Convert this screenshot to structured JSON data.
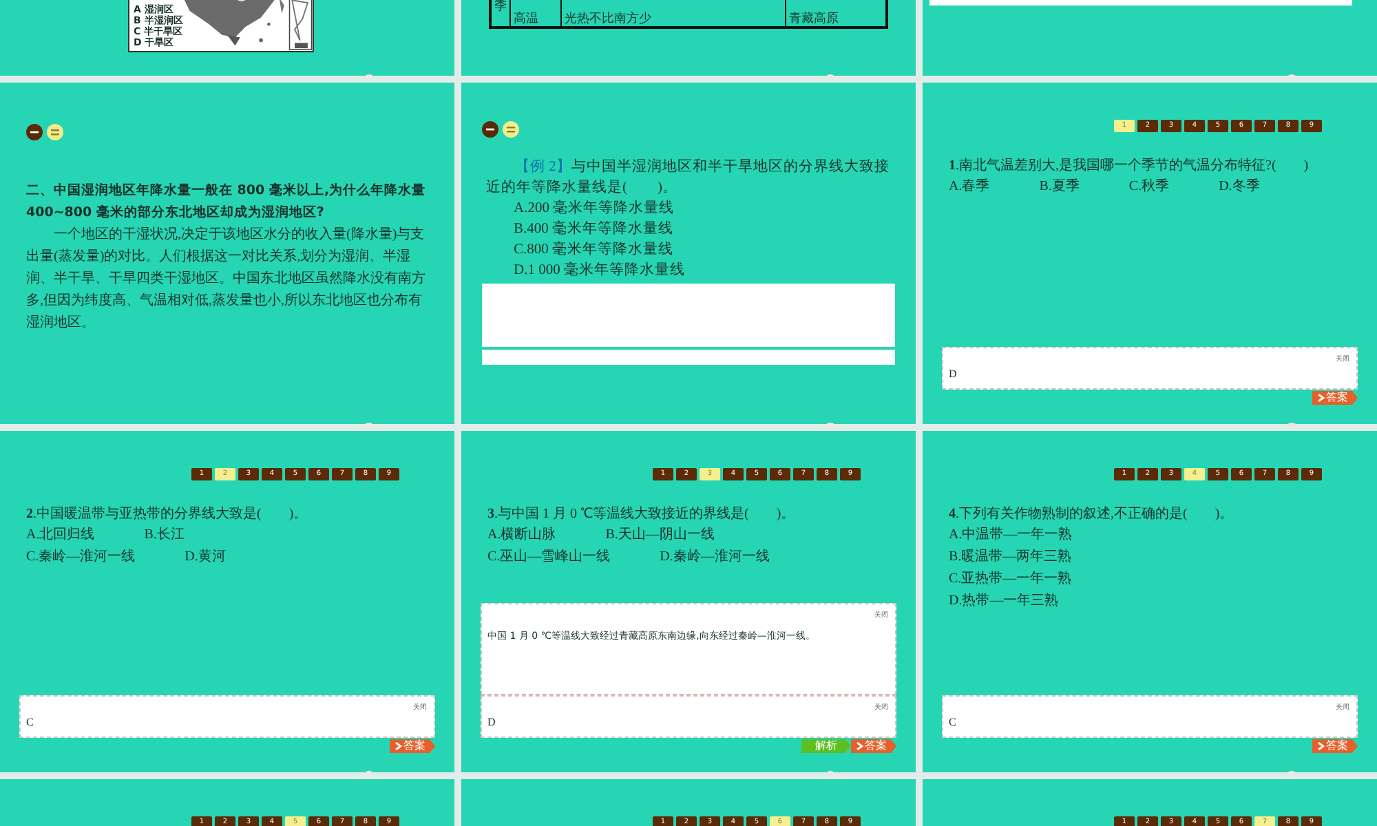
{
  "slides": [
    {
      "kind": "map",
      "legend": [
        "A 湿润区",
        "B 半湿润区",
        "C 半干旱区",
        "D 干旱区"
      ]
    },
    {
      "kind": "table",
      "cells": [
        {
          "text": "季"
        },
        {
          "text": "高温"
        },
        {
          "text": "光热不比南方少"
        },
        {
          "text": "青藏高原"
        }
      ]
    },
    {
      "kind": "strip"
    },
    {
      "kind": "text",
      "heading": "二、中国湿润地区年降水量一般在 800 毫米以上,为什么年降水量 400~800 毫米的部分东北地区却成为湿润地区?",
      "paragraph": "一个地区的干湿状况,决定于该地区水分的收入量(降水量)与支出量(蒸发量)的对比。人们根据这一对比关系,划分为湿润、半湿润、半干旱、干旱四类干湿地区。中国东北地区虽然降水没有南方多,但因为纬度高、气温相对低,蒸发量也小,所以东北地区也分布有湿润地区。"
    },
    {
      "kind": "example",
      "tag": "【例 2】",
      "question": "与中国半湿润地区和半干旱地区的分界线大致接近的年等降水量线是(　　)。",
      "options": [
        "A.200 毫米年等降水量线",
        "B.400 毫米年等降水量线",
        "C.800 毫米年等降水量线",
        "D.1 000 毫米年等降水量线"
      ]
    },
    {
      "kind": "quiz",
      "nav": [
        {
          "label": "1",
          "selected": true
        },
        {
          "label": "2",
          "selected": false
        },
        {
          "label": "3",
          "selected": false
        },
        {
          "label": "4",
          "selected": false
        },
        {
          "label": "5",
          "selected": false
        },
        {
          "label": "6",
          "selected": false
        },
        {
          "label": "7",
          "selected": false
        },
        {
          "label": "8",
          "selected": false
        },
        {
          "label": "9",
          "selected": false
        }
      ],
      "question": "**1**.南北气温差别大,是我国哪一个季节的气温分布特征?(　　)",
      "option_rows": [
        [
          "A.春季",
          "B.夏季",
          "C.秋季",
          "D.冬季"
        ]
      ],
      "boxes": [
        {
          "kind": "answer",
          "close": "关闭",
          "text": "D"
        }
      ],
      "buttons": [
        {
          "kind": "answer",
          "label": "答案"
        }
      ]
    },
    {
      "kind": "quiz",
      "nav": [
        {
          "label": "1",
          "selected": false
        },
        {
          "label": "2",
          "selected": true
        },
        {
          "label": "3",
          "selected": false
        },
        {
          "label": "4",
          "selected": false
        },
        {
          "label": "5",
          "selected": false
        },
        {
          "label": "6",
          "selected": false
        },
        {
          "label": "7",
          "selected": false
        },
        {
          "label": "8",
          "selected": false
        },
        {
          "label": "9",
          "selected": false
        }
      ],
      "question": "**2**.中国暖温带与亚热带的分界线大致是(　　)。",
      "option_rows": [
        [
          "A.北回归线",
          "B.长江"
        ],
        [
          "C.秦岭—淮河一线",
          "D.黄河"
        ]
      ],
      "boxes": [
        {
          "kind": "answer",
          "close": "关闭",
          "text": "C"
        }
      ],
      "buttons": [
        {
          "kind": "answer",
          "label": "答案"
        }
      ]
    },
    {
      "kind": "quiz",
      "nav": [
        {
          "label": "1",
          "selected": false
        },
        {
          "label": "2",
          "selected": false
        },
        {
          "label": "3",
          "selected": true
        },
        {
          "label": "4",
          "selected": false
        },
        {
          "label": "5",
          "selected": false
        },
        {
          "label": "6",
          "selected": false
        },
        {
          "label": "7",
          "selected": false
        },
        {
          "label": "8",
          "selected": false
        },
        {
          "label": "9",
          "selected": false
        }
      ],
      "question": "**3**.与中国 1 月 0 ℃等温线大致接近的界线是(　　)。",
      "option_rows": [
        [
          "A.横断山脉",
          "B.天山—阴山一线"
        ],
        [
          "C.巫山—雪峰山一线",
          "D.秦岭—淮河一线"
        ]
      ],
      "boxes": [
        {
          "kind": "explanation",
          "close": "关闭",
          "text": "中国 1 月 0 ℃等温线大致经过青藏高原东南边缘,向东经过秦岭—淮河一线。"
        },
        {
          "kind": "answer",
          "close": "关闭",
          "text": "D"
        }
      ],
      "buttons": [
        {
          "kind": "explanation",
          "label": "解析"
        },
        {
          "kind": "answer",
          "label": "答案"
        }
      ]
    },
    {
      "kind": "quiz",
      "nav": [
        {
          "label": "1",
          "selected": false
        },
        {
          "label": "2",
          "selected": false
        },
        {
          "label": "3",
          "selected": false
        },
        {
          "label": "4",
          "selected": true
        },
        {
          "label": "5",
          "selected": false
        },
        {
          "label": "6",
          "selected": false
        },
        {
          "label": "7",
          "selected": false
        },
        {
          "label": "8",
          "selected": false
        },
        {
          "label": "9",
          "selected": false
        }
      ],
      "question": "**4**.下列有关作物熟制的叙述,不正确的是(　　)。",
      "option_rows": [
        [
          "A.中温带—一年一熟"
        ],
        [
          "B.暖温带—两年三熟"
        ],
        [
          "C.亚热带—一年一熟"
        ],
        [
          "D.热带—一年三熟"
        ]
      ],
      "boxes": [
        {
          "kind": "answer",
          "close": "关闭",
          "text": "C"
        }
      ],
      "buttons": [
        {
          "kind": "answer",
          "label": "答案"
        }
      ]
    },
    {
      "kind": "quiz",
      "nav": [
        {
          "label": "1",
          "selected": false
        },
        {
          "label": "2",
          "selected": false
        },
        {
          "label": "3",
          "selected": false
        },
        {
          "label": "4",
          "selected": false
        },
        {
          "label": "5",
          "selected": true
        },
        {
          "label": "6",
          "selected": false
        },
        {
          "label": "7",
          "selected": false
        },
        {
          "label": "8",
          "selected": false
        },
        {
          "label": "9",
          "selected": false
        }
      ]
    },
    {
      "kind": "quiz",
      "nav": [
        {
          "label": "1",
          "selected": false
        },
        {
          "label": "2",
          "selected": false
        },
        {
          "label": "3",
          "selected": false
        },
        {
          "label": "4",
          "selected": false
        },
        {
          "label": "5",
          "selected": false
        },
        {
          "label": "6",
          "selected": true
        },
        {
          "label": "7",
          "selected": false
        },
        {
          "label": "8",
          "selected": false
        },
        {
          "label": "9",
          "selected": false
        }
      ]
    },
    {
      "kind": "quiz",
      "nav": [
        {
          "label": "1",
          "selected": false
        },
        {
          "label": "2",
          "selected": false
        },
        {
          "label": "3",
          "selected": false
        },
        {
          "label": "4",
          "selected": false
        },
        {
          "label": "5",
          "selected": false
        },
        {
          "label": "6",
          "selected": false
        },
        {
          "label": "7",
          "selected": true
        },
        {
          "label": "8",
          "selected": false
        },
        {
          "label": "9",
          "selected": false
        }
      ]
    }
  ]
}
